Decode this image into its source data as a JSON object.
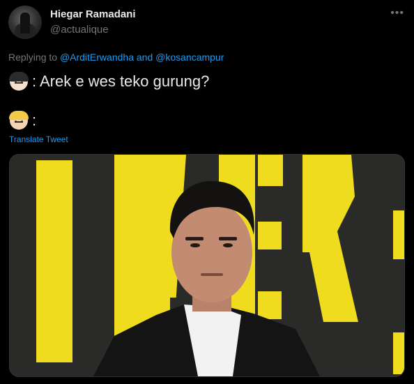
{
  "tweet": {
    "author_name": "Hiegar Ramadani",
    "author_handle": "@actualique",
    "more_icon": "more-horizontal-icon",
    "replying_prefix": "Replying to ",
    "reply_to_1": "@ArditErwandha",
    "reply_and": " and ",
    "reply_to_2": "@kosancampur",
    "line1_text": ": Arek e wes teko gurung?",
    "line2_text": ":",
    "translate_label": "Translate Tweet",
    "emoji_1": "person-dark-hair-emoji",
    "emoji_2": "person-blond-hair-emoji"
  },
  "colors": {
    "background": "#000000",
    "text": "#e7e9ea",
    "secondary": "#71767b",
    "link": "#1d9bf0",
    "poster_yellow": "#f0dc1c"
  }
}
